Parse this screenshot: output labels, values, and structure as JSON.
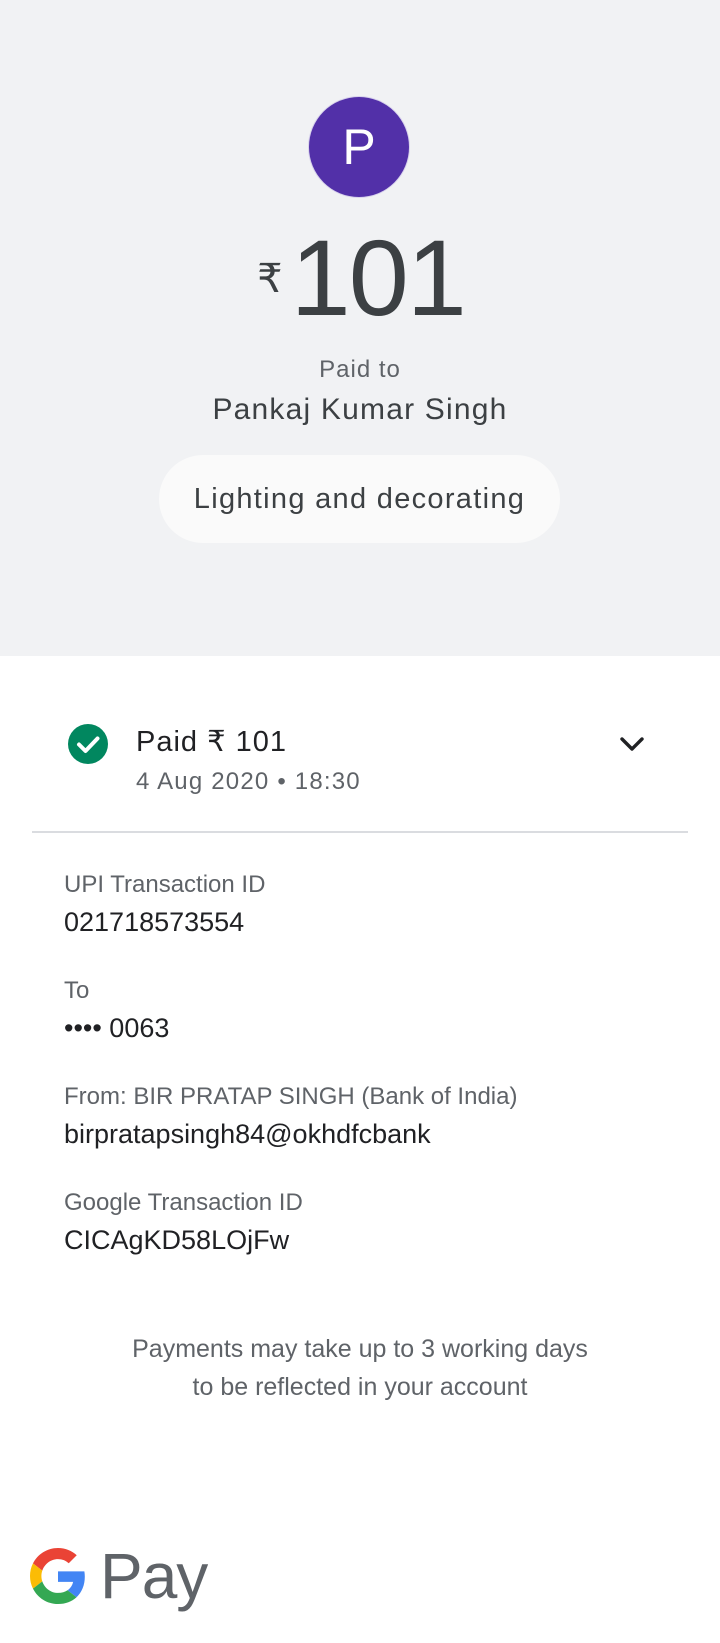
{
  "header": {
    "avatar_initial": "P",
    "currency_symbol": "₹",
    "amount": "101",
    "paid_to_label": "Paid to",
    "payee_name": "Pankaj Kumar Singh",
    "note": "Lighting and decorating"
  },
  "status": {
    "title": "Paid ₹ 101",
    "datetime": "4 Aug 2020 • 18:30",
    "icon": "check-circle-icon",
    "icon_color": "#01875f"
  },
  "details": {
    "upi_label": "UPI Transaction ID",
    "upi_value": "021718573554",
    "to_label": "To",
    "to_value": "•••• 0063",
    "from_label": "From: BIR PRATAP SINGH (Bank of India)",
    "from_value": "birpratapsingh84@okhdfcbank",
    "google_label": "Google Transaction ID",
    "google_value": "CICAgKD58LOjFw"
  },
  "footnote": {
    "line1": "Payments may take up to 3 working days",
    "line2": "to be reflected in your account"
  },
  "branding": {
    "pay_text": "Pay",
    "logo_icon": "google-g-icon"
  },
  "colors": {
    "avatar_bg": "#5230a8",
    "top_bg": "#f1f2f4",
    "success": "#01875f"
  }
}
